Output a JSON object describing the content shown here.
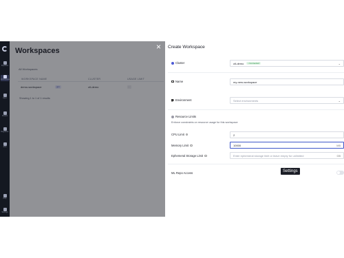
{
  "nav": {
    "items": [
      {
        "label": "Pipelines",
        "icon": "pipeline-icon"
      },
      {
        "label": "Workspaces",
        "icon": "workspace-icon",
        "active": true
      },
      {
        "label": "Apps",
        "icon": "apps-icon"
      },
      {
        "label": "Models",
        "icon": "models-icon"
      },
      {
        "label": "Registries",
        "icon": "registries-icon"
      },
      {
        "label": "Jobs",
        "icon": "jobs-icon"
      }
    ],
    "bottom": [
      {
        "label": "Help",
        "icon": "help-icon"
      },
      {
        "label": "Settings",
        "icon": "settings-icon"
      }
    ]
  },
  "background_page": {
    "title": "Workspaces",
    "subtitle": "All Workspaces",
    "columns": [
      "WORKSPACE NAME",
      "CLUSTER",
      "USAGE LIMIT"
    ],
    "row": {
      "name": "demo-workspace",
      "badge": "gpu",
      "cluster": "ctl-demo",
      "limit": "..."
    },
    "footer": "Showing 1 to 1 of 1 results"
  },
  "drawer": {
    "close": "×",
    "title": "Create Workspace",
    "cluster": {
      "label": "Cluster",
      "value": "ctl-demo",
      "status": "• Connected"
    },
    "name": {
      "label": "Name",
      "value": "my-new-workspace"
    },
    "environment": {
      "label": "Environment",
      "placeholder": "Select environments"
    },
    "resource_limits": {
      "label": "Resource Limits",
      "description": "Enforce constraints on resource usage for this workspace"
    },
    "cpu": {
      "label": "CPU Limit",
      "value": "2"
    },
    "memory": {
      "label": "Memory Limit",
      "value": "10000",
      "unit": "MB"
    },
    "storage": {
      "label": "Ephemeral Storage Limit",
      "placeholder": "Enter ephemeral storage limit or leave empty for unlimited",
      "unit": "GB"
    },
    "ml_repo": {
      "label": "ML Repo Access",
      "enabled": false
    }
  },
  "tooltip": "Settings",
  "colors": {
    "accent": "#3d56c9",
    "connected": "#1f8a3c",
    "nav_bg": "#141821"
  }
}
